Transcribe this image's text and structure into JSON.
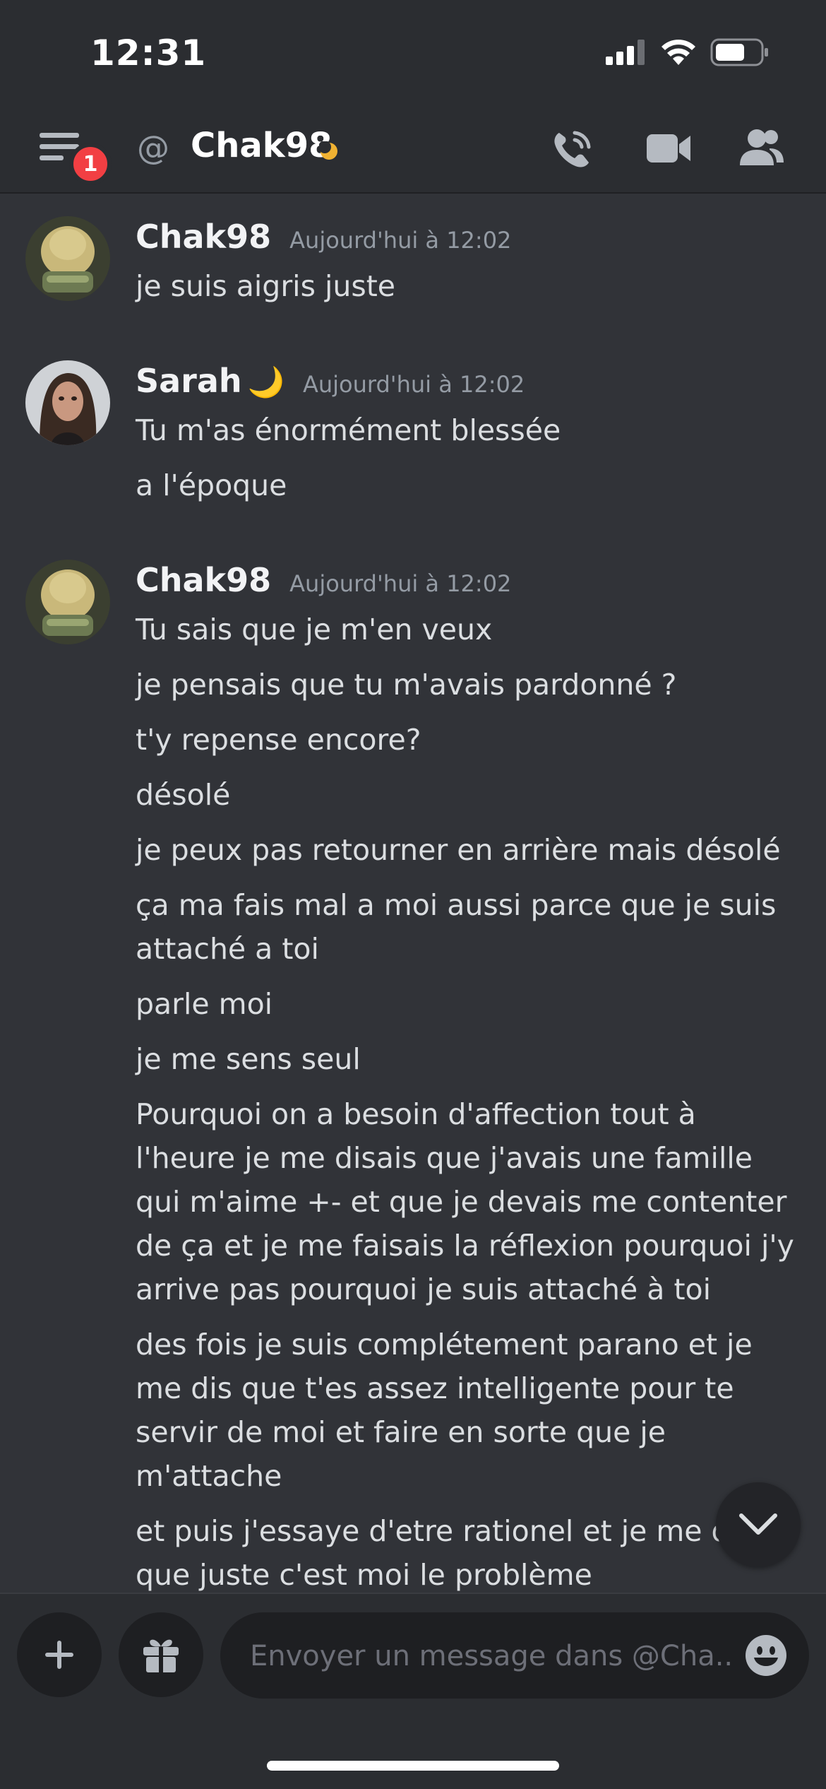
{
  "status_bar": {
    "time": "12:31"
  },
  "header": {
    "badge_count": "1",
    "at_symbol": "@",
    "channel_name": "Chak98"
  },
  "messages": [
    {
      "author": "Chak98",
      "author_emoji": "",
      "timestamp": "Aujourd'hui à 12:02",
      "lines": [
        "je suis aigris juste"
      ]
    },
    {
      "author": "Sarah",
      "author_emoji": "🌙",
      "timestamp": "Aujourd'hui à 12:02",
      "lines": [
        "Tu m'as énormément blessée",
        "a l'époque"
      ]
    },
    {
      "author": "Chak98",
      "author_emoji": "",
      "timestamp": "Aujourd'hui à 12:02",
      "lines": [
        "Tu sais que je m'en veux",
        "je pensais que tu m'avais pardonné ?",
        "t'y repense encore?",
        "désolé",
        "je peux pas retourner en arrière mais désolé",
        "ça ma fais mal a moi aussi parce que je suis attaché a toi",
        "parle moi",
        "je me sens seul",
        "Pourquoi on a besoin d'affection tout à l'heure je me disais que j'avais une famille qui m'aime +- et que je devais me contenter de ça et je me faisais la réflexion pourquoi j'y arrive pas pourquoi je suis attaché à toi",
        "des fois je suis complétement parano et je me dis que t'es assez intelligente pour te servir de moi et faire en sorte que je m'attache",
        "et puis j'essaye d'etre rationel et je me dis que juste c'est moi le problème"
      ]
    }
  ],
  "composer": {
    "placeholder": "Envoyer un message dans @Cha.."
  },
  "colors": {
    "background": "#313338",
    "header_bg": "#2b2d31",
    "badge": "#f23f43",
    "idle_status": "#f0b232"
  }
}
